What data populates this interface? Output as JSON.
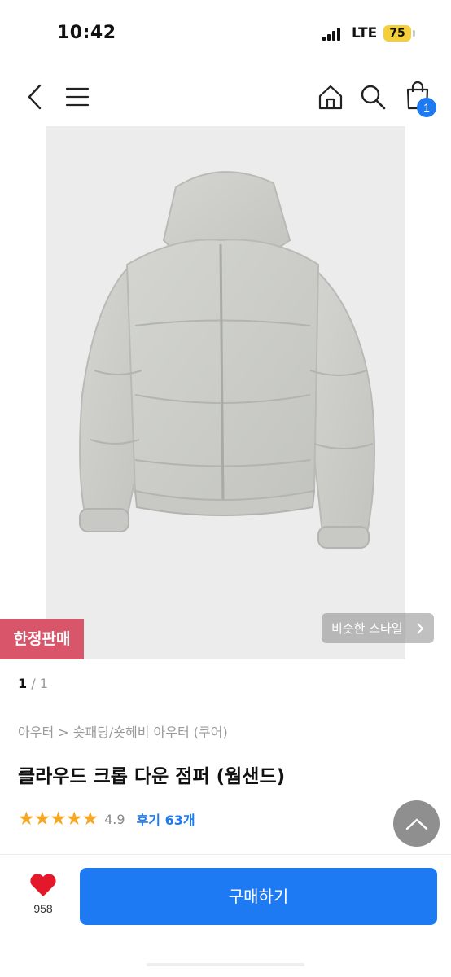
{
  "status_bar": {
    "time": "10:42",
    "network": "LTE",
    "battery": "75"
  },
  "nav": {
    "back_icon": "chevron-left-icon",
    "menu_icon": "hamburger-menu-icon",
    "home_icon": "home-icon",
    "search_icon": "search-icon",
    "cart_icon": "shopping-bag-icon",
    "cart_count": "1"
  },
  "image": {
    "limited_badge": "한정판매",
    "similar_style": "비슷한 스타일",
    "pager_current": "1",
    "pager_total": "/ 1"
  },
  "product": {
    "breadcrumb": "아우터 > 숏패딩/숏헤비 아우터 (쿠어)",
    "title": "클라우드 크롭 다운 점퍼 (웜샌드)",
    "stars": "★★★★★",
    "rating": "4.9",
    "reviews": "후기 63개"
  },
  "bottom_bar": {
    "like_count": "958",
    "buy_label": "구매하기"
  },
  "colors": {
    "accent": "#1d7af3",
    "badge": "#d9566a",
    "star": "#f5a623"
  }
}
